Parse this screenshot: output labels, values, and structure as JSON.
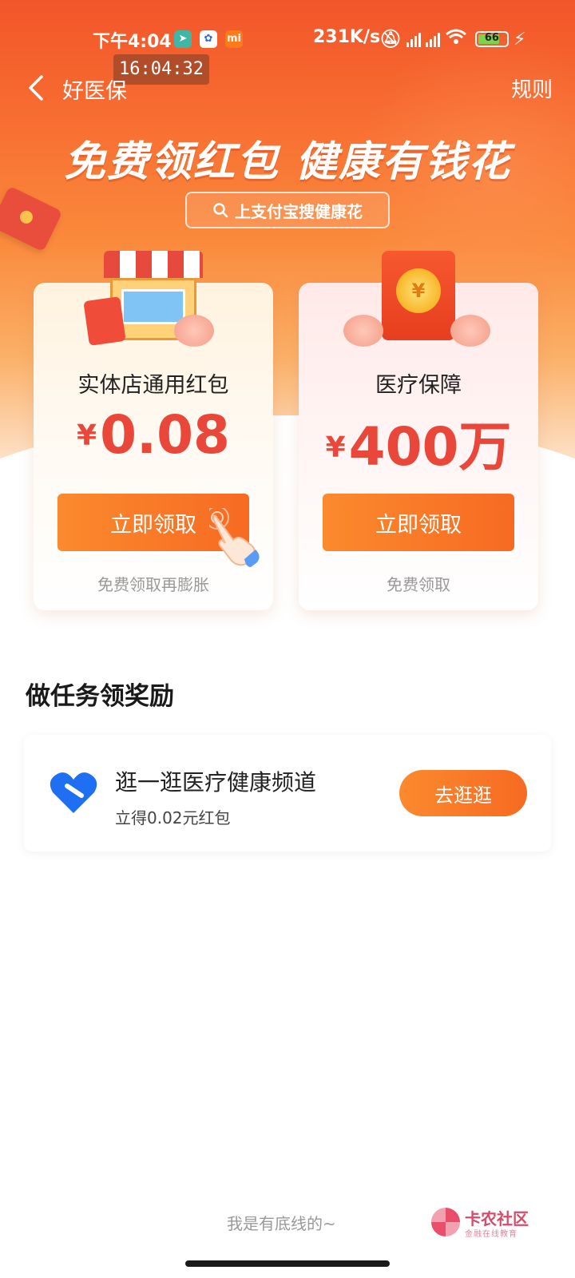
{
  "status_bar": {
    "time": "下午4:04",
    "speed": "231K/s",
    "battery": "66",
    "app_icons": [
      "navigation-icon",
      "baidu-icon",
      "mi-icon"
    ]
  },
  "overlay_clock": "16:04:32",
  "nav": {
    "back_icon": "chevron-left-icon",
    "title": "好医保",
    "rules": "规则"
  },
  "hero": {
    "slogan": "免费领红包  健康有钱花",
    "search_text": "上支付宝搜健康花"
  },
  "cards": [
    {
      "title": "实体店通用红包",
      "currency": "¥",
      "amount": "0.08",
      "button": "立即领取",
      "note": "免费领取再膨胀"
    },
    {
      "title": "医疗保障",
      "currency": "¥",
      "amount": "400万",
      "button": "立即领取",
      "note": "免费领取"
    }
  ],
  "tasks": {
    "heading": "做任务领奖励",
    "items": [
      {
        "title": "逛一逛医疗健康频道",
        "subtitle": "立得0.02元红包",
        "button": "去逛逛"
      }
    ]
  },
  "footer": {
    "text": "我是有底线的~",
    "watermark_title": "卡农社区",
    "watermark_sub": "金融在线教育"
  },
  "colors": {
    "accent_orange": "#f76a22",
    "amount_red": "#e9473a",
    "health_blue": "#1f6ff2"
  }
}
